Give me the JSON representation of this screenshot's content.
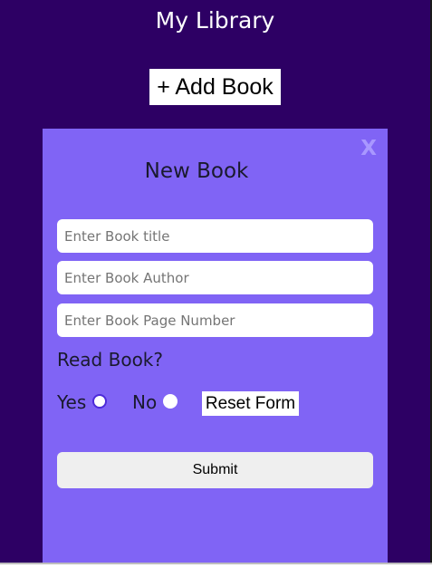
{
  "app": {
    "title": "My Library",
    "add_book_label": "+ Add Book"
  },
  "modal": {
    "title": "New Book",
    "close_label": "X",
    "fields": {
      "title_placeholder": "Enter Book title",
      "author_placeholder": "Enter Book Author",
      "pages_placeholder": "Enter Book Page Number",
      "title_value": "",
      "author_value": "",
      "pages_value": ""
    },
    "read_question": "Read Book?",
    "radio_yes_label": "Yes",
    "radio_no_label": "No",
    "selected_read_option": "Yes",
    "reset_label": "Reset Form",
    "submit_label": "Submit"
  },
  "colors": {
    "page_background": "#2d0064",
    "modal_background": "#8064f5",
    "close_icon": "#a998ff",
    "radio_selected_ring": "#4d2bd9"
  },
  "icons": {
    "close": "close-icon",
    "radio_selected": "radio-checked-icon",
    "radio_unselected": "radio-unchecked-icon"
  }
}
